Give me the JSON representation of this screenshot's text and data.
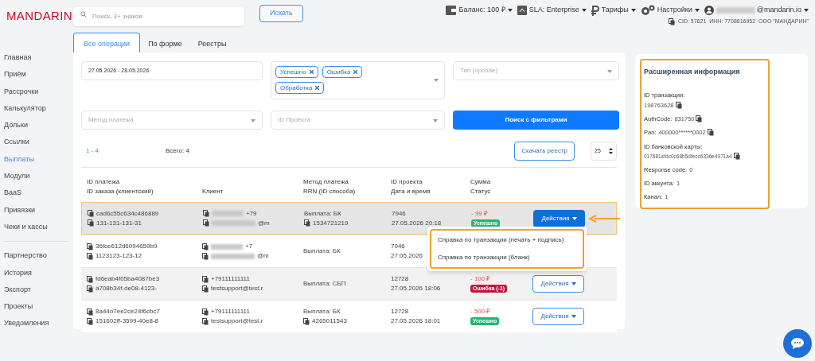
{
  "logo": "MANDARIN",
  "search": {
    "placeholder": "Поиск, 3+ знаков",
    "button": "Искать"
  },
  "header_menu": [
    {
      "kind": "wallet",
      "label": "Баланс: 100 ₽"
    },
    {
      "kind": "sla",
      "label": "SLA: Enterprise"
    },
    {
      "kind": "ruble",
      "label": "Тарифы"
    },
    {
      "kind": "gears",
      "label": "Настройки"
    }
  ],
  "user": {
    "email": "@mandarin.io",
    "details": "CID: 57621  ИНН: 7708816952  ООО \"МАНДАРИН\""
  },
  "sidebar": {
    "groups": [
      [
        {
          "label": "Главная",
          "selected": false
        },
        {
          "label": "Приём",
          "selected": false
        },
        {
          "label": "Рассрочки",
          "selected": false
        },
        {
          "label": "Калькулятор",
          "selected": false
        },
        {
          "label": "Дольки",
          "selected": false
        },
        {
          "label": "Ссылки",
          "selected": false
        },
        {
          "label": "Выплаты",
          "selected": true
        },
        {
          "label": "Модули",
          "selected": false
        },
        {
          "label": "BaaS",
          "selected": false
        },
        {
          "label": "Привязки",
          "selected": false
        },
        {
          "label": "Чеки и кассы",
          "selected": false
        }
      ],
      [
        {
          "label": "Партнерство",
          "selected": false
        },
        {
          "label": "История",
          "selected": false
        },
        {
          "label": "Экспорт",
          "selected": false
        },
        {
          "label": "Проекты",
          "selected": false
        },
        {
          "label": "Уведомления",
          "selected": false
        }
      ]
    ]
  },
  "tabs": [
    {
      "label": "Все операции",
      "selected": true
    },
    {
      "label": "По форме",
      "selected": false
    },
    {
      "label": "Реестры",
      "selected": false
    }
  ],
  "filters": {
    "date_range": "27.05.2026 - 28.05.2026",
    "status_tags": [
      "Успешно",
      "Ошибка",
      "Обработка"
    ],
    "type_placeholder": "Тип (opcode)",
    "method_placeholder": "Метод платежа",
    "project_placeholder": "ID Проекта",
    "search_button": "Поиск с фильтрами"
  },
  "pager": {
    "range": "1 - 4",
    "total": "Всего: 4",
    "download": "Скачать реестр",
    "page_size": "25"
  },
  "table": {
    "columns": [
      [
        "ID платежа",
        "ID заказа (клиентский)"
      ],
      [
        "Клиент"
      ],
      [
        "Метод платежа",
        "RRN (ID способа)"
      ],
      [
        "ID проекта",
        "Дата и время"
      ],
      [
        "Сумма",
        "Статус"
      ]
    ],
    "rows": [
      {
        "selected": true,
        "ids": [
          "cad6c55c634c486889",
          "131-131-131-31"
        ],
        "client": [
          {
            "text": "+79",
            "blurred": true
          },
          {
            "text": "@m",
            "blurred": true
          }
        ],
        "method": [
          {
            "text": "Выплата: БК",
            "copy": false
          },
          {
            "text": "1534721219",
            "copy": true
          }
        ],
        "project": [
          "7946",
          "27.05.2026 20:18"
        ],
        "amount": "- 99 ₽",
        "status": {
          "kind": "success",
          "text": "Успешно"
        },
        "action": {
          "label": "Действия",
          "open": true
        }
      },
      {
        "selected": false,
        "ids": [
          "36fce612d6094659b9",
          "1123123-123-12"
        ],
        "client": [
          {
            "text": "+7",
            "blurred": true
          },
          {
            "text": "@m",
            "blurred": true
          }
        ],
        "method": [
          {
            "text": "Выплата: БК",
            "copy": false
          }
        ],
        "project": [
          "7946",
          "27.05.2026"
        ]
      },
      {
        "selected": false,
        "ids": [
          "fd6eab4f05ba4087be3",
          "a708b34f-de08-4123-"
        ],
        "client": [
          {
            "text": "+79111111111",
            "blurred": false
          },
          {
            "text": "testsupport@test.r",
            "blurred": false
          }
        ],
        "method": [
          {
            "text": "Выплата: СБП",
            "copy": false
          }
        ],
        "project": [
          "12728",
          "27.05.2026 18:06"
        ],
        "amount": "- 100 ₽",
        "status": {
          "kind": "error",
          "text": "Ошибка (-1)"
        },
        "action": {
          "label": "Действия",
          "open": false
        }
      },
      {
        "selected": false,
        "ids": [
          "8a44o7ee2ce24f6cbc7",
          "151602ff-3599-40e8-8"
        ],
        "client": [
          {
            "text": "+79111111111",
            "blurred": false
          },
          {
            "text": "testsupport@test.r",
            "blurred": false
          }
        ],
        "method": [
          {
            "text": "Выплата: БК",
            "copy": false
          },
          {
            "text": "4265011543",
            "copy": true
          }
        ],
        "project": [
          "12728",
          "27.05.2026 18:01"
        ],
        "amount": "- 500 ₽",
        "status": {
          "kind": "success",
          "text": "Успешно"
        },
        "action": {
          "label": "Действия",
          "open": false
        }
      }
    ]
  },
  "dropdown": [
    "Справка по транзакции (печать + подпись)",
    "Справка по транзакции (бланк)"
  ],
  "info": {
    "title": "Расширенная информация",
    "fields": [
      {
        "label": "ID транзакции:",
        "value": "198763628",
        "copy": true,
        "stacked": true
      },
      {
        "label": "AuthCode:",
        "value": "831750",
        "copy": true,
        "stacked": false
      },
      {
        "label": "Pan:",
        "value": "400000******0002",
        "copy": true,
        "stacked": false
      },
      {
        "label": "ID банковской карты:",
        "value": "017681efdc0c68b5dfecc6336e4971a4",
        "copy": true,
        "stacked": true
      },
      {
        "label": "Response code:",
        "value": "0",
        "copy": false,
        "stacked": false
      },
      {
        "label": "ID аккунта:",
        "value": "1",
        "copy": false,
        "stacked": false
      },
      {
        "label": "Канал:",
        "value": "1",
        "copy": false,
        "stacked": false
      }
    ]
  }
}
